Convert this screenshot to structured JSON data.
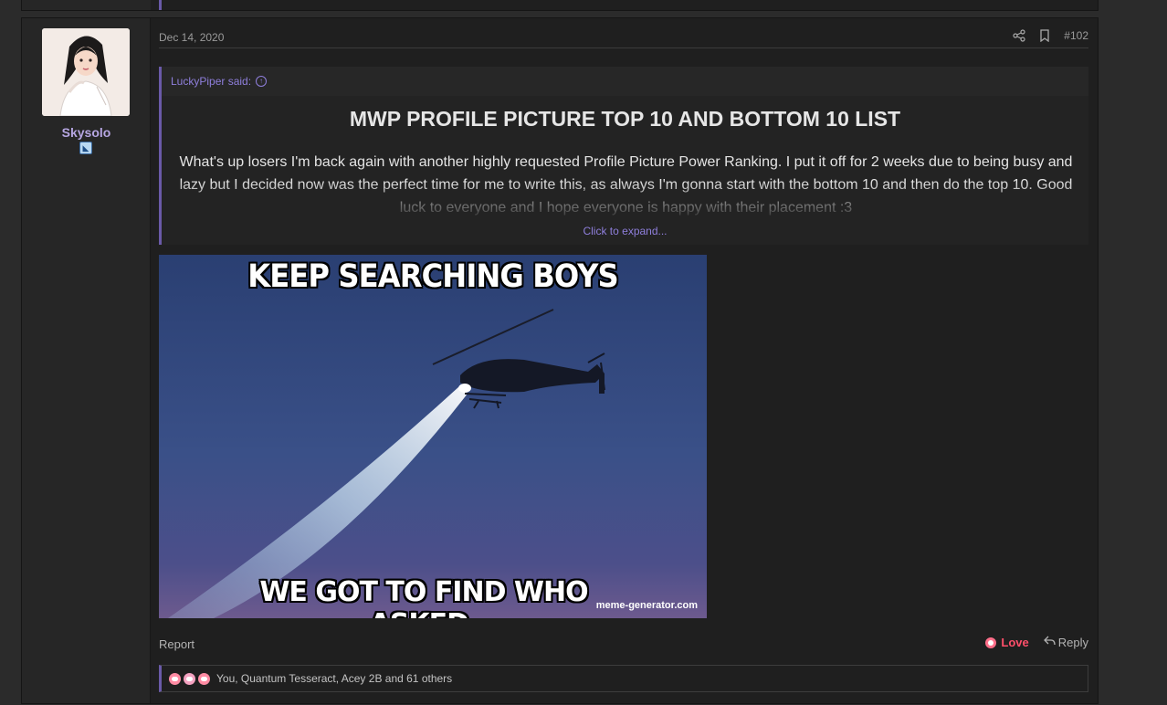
{
  "post": {
    "date": "Dec 14, 2020",
    "number": "#102",
    "author": {
      "name": "Skysolo"
    },
    "quote": {
      "author_label": "LuckyPiper said:",
      "title": "MWP PROFILE PICTURE TOP 10 AND BOTTOM 10 LIST",
      "body": "What's up losers I'm back again with another highly requested Profile Picture Power Ranking. I put it off for 2 weeks due to being busy and lazy but I decided now was the perfect time for me to write this, as always I'm gonna start with the bottom 10 and then do the top 10. Good luck to everyone and I hope everyone is happy with their placement :3",
      "expand_label": "Click to expand..."
    },
    "image": {
      "top_text": "KEEP SEARCHING BOYS",
      "bottom_text": "WE GOT TO FIND WHO ASKED.",
      "watermark": "meme-generator.com"
    },
    "footer": {
      "report_label": "Report",
      "love_label": "Love",
      "reply_label": "Reply"
    },
    "reactions": {
      "text": "You, Quantum Tesseract, Acey 2B and 61 others"
    }
  },
  "colors": {
    "accent": "#6a5aa8",
    "link": "#8f7fdc",
    "love": "#ff4f6a",
    "username": "#b6a6e2"
  },
  "icons": {
    "share": "share-icon",
    "bookmark": "bookmark-icon",
    "quote_jump": "arrow-up-circle-icon",
    "love": "love-reaction-icon",
    "reply": "reply-icon"
  }
}
